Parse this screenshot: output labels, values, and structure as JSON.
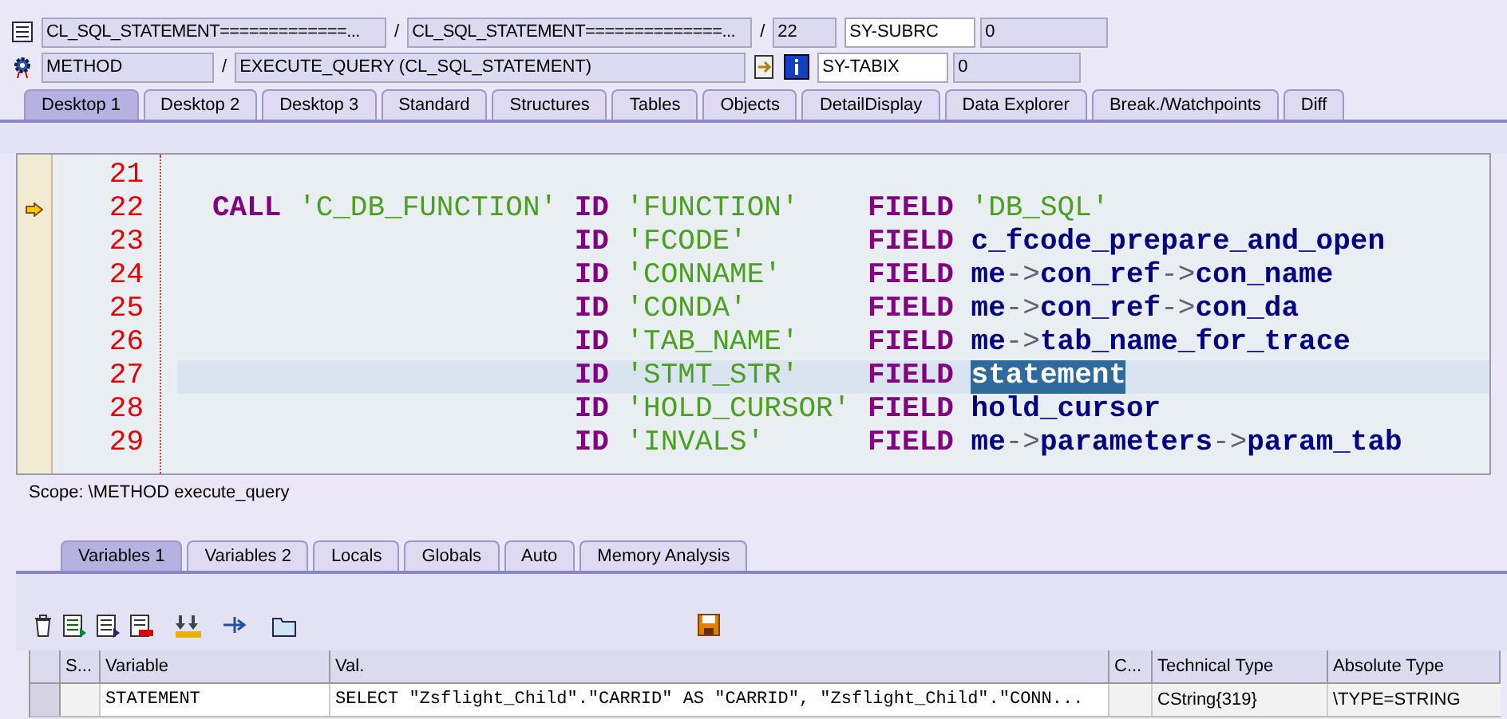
{
  "header_rows": [
    {
      "fields": [
        {
          "kind": "field",
          "text": "CL_SQL_STATEMENT=============..."
        },
        {
          "kind": "sep",
          "text": "/"
        },
        {
          "kind": "field",
          "text": "CL_SQL_STATEMENT==============..."
        },
        {
          "kind": "sep",
          "text": "/"
        },
        {
          "kind": "short",
          "text": "22"
        },
        {
          "kind": "label",
          "text": "SY-SUBRC"
        },
        {
          "kind": "value",
          "text": "0"
        }
      ]
    },
    {
      "fields": [
        {
          "kind": "medium",
          "text": "METHOD"
        },
        {
          "kind": "sep",
          "text": "/"
        },
        {
          "kind": "wide",
          "text": "EXECUTE_QUERY (CL_SQL_STATEMENT)"
        },
        {
          "kind": "buttons"
        },
        {
          "kind": "label",
          "text": "SY-TABIX"
        },
        {
          "kind": "value",
          "text": "0"
        }
      ]
    }
  ],
  "tabs": [
    {
      "label": "Desktop 1",
      "selected": true
    },
    {
      "label": "Desktop 2",
      "selected": false
    },
    {
      "label": "Desktop 3",
      "selected": false
    },
    {
      "label": "Standard",
      "selected": false
    },
    {
      "label": "Structures",
      "selected": false
    },
    {
      "label": "Tables",
      "selected": false
    },
    {
      "label": "Objects",
      "selected": false
    },
    {
      "label": "DetailDisplay",
      "selected": false
    },
    {
      "label": "Data Explorer",
      "selected": false
    },
    {
      "label": "Break./Watchpoints",
      "selected": false
    },
    {
      "label": "Diff",
      "selected": false
    }
  ],
  "code": {
    "lines": [
      {
        "number": "21",
        "current": false,
        "highlighted": false,
        "columns": [
          [],
          [],
          []
        ]
      },
      {
        "number": "22",
        "current": true,
        "highlighted": false,
        "columns": [
          [
            {
              "kind": "keyword",
              "text": "CALL"
            },
            {
              "kind": "string",
              "text": "'C_DB_FUNCTION'"
            }
          ],
          [
            {
              "kind": "keyword",
              "text": "ID"
            },
            {
              "kind": "string",
              "text": "'FUNCTION'"
            }
          ],
          [
            {
              "kind": "keyword",
              "text": "FIELD"
            },
            {
              "kind": "string",
              "text": "'DB_SQL'"
            }
          ]
        ]
      },
      {
        "number": "23",
        "current": false,
        "highlighted": false,
        "columns": [
          [],
          [
            {
              "kind": "keyword",
              "text": "ID"
            },
            {
              "kind": "string",
              "text": "'FCODE'"
            }
          ],
          [
            {
              "kind": "keyword",
              "text": "FIELD"
            },
            {
              "kind": "ident",
              "text": "c_fcode_prepare_and_open"
            }
          ]
        ]
      },
      {
        "number": "24",
        "current": false,
        "highlighted": false,
        "columns": [
          [],
          [
            {
              "kind": "keyword",
              "text": "ID"
            },
            {
              "kind": "string",
              "text": "'CONNAME'"
            }
          ],
          [
            {
              "kind": "keyword",
              "text": "FIELD"
            },
            {
              "kind": "ident",
              "text": "me"
            },
            {
              "kind": "arrow",
              "text": "->"
            },
            {
              "kind": "ident",
              "text": "con_ref"
            },
            {
              "kind": "arrow",
              "text": "->"
            },
            {
              "kind": "ident",
              "text": "con_name"
            }
          ]
        ]
      },
      {
        "number": "25",
        "current": false,
        "highlighted": false,
        "columns": [
          [],
          [
            {
              "kind": "keyword",
              "text": "ID"
            },
            {
              "kind": "string",
              "text": "'CONDA'"
            }
          ],
          [
            {
              "kind": "keyword",
              "text": "FIELD"
            },
            {
              "kind": "ident",
              "text": "me"
            },
            {
              "kind": "arrow",
              "text": "->"
            },
            {
              "kind": "ident",
              "text": "con_ref"
            },
            {
              "kind": "arrow",
              "text": "->"
            },
            {
              "kind": "ident",
              "text": "con_da"
            }
          ]
        ]
      },
      {
        "number": "26",
        "current": false,
        "highlighted": false,
        "columns": [
          [],
          [
            {
              "kind": "keyword",
              "text": "ID"
            },
            {
              "kind": "string",
              "text": "'TAB_NAME'"
            }
          ],
          [
            {
              "kind": "keyword",
              "text": "FIELD"
            },
            {
              "kind": "ident",
              "text": "me"
            },
            {
              "kind": "arrow",
              "text": "->"
            },
            {
              "kind": "ident",
              "text": "tab_name_for_trace"
            }
          ]
        ]
      },
      {
        "number": "27",
        "current": false,
        "highlighted": true,
        "columns": [
          [],
          [
            {
              "kind": "keyword",
              "text": "ID"
            },
            {
              "kind": "string",
              "text": "'STMT_STR'"
            }
          ],
          [
            {
              "kind": "keyword",
              "text": "FIELD"
            },
            {
              "kind": "selection",
              "text": "statement"
            }
          ]
        ]
      },
      {
        "number": "28",
        "current": false,
        "highlighted": false,
        "columns": [
          [],
          [
            {
              "kind": "keyword",
              "text": "ID"
            },
            {
              "kind": "string",
              "text": "'HOLD_CURSOR'"
            }
          ],
          [
            {
              "kind": "keyword",
              "text": "FIELD"
            },
            {
              "kind": "ident",
              "text": "hold_cursor"
            }
          ]
        ]
      },
      {
        "number": "29",
        "current": false,
        "highlighted": false,
        "columns": [
          [],
          [
            {
              "kind": "keyword",
              "text": "ID"
            },
            {
              "kind": "string",
              "text": "'INVALS'"
            }
          ],
          [
            {
              "kind": "keyword",
              "text": "FIELD"
            },
            {
              "kind": "ident",
              "text": "me"
            },
            {
              "kind": "arrow",
              "text": "->"
            },
            {
              "kind": "ident",
              "text": "parameters"
            },
            {
              "kind": "arrow",
              "text": "->"
            },
            {
              "kind": "ident",
              "text": "param_tab"
            }
          ]
        ]
      }
    ]
  },
  "scope": "Scope: \\METHOD execute_query",
  "bottom_tabs": [
    {
      "label": "Variables 1",
      "selected": true
    },
    {
      "label": "Variables 2",
      "selected": false
    },
    {
      "label": "Locals",
      "selected": false
    },
    {
      "label": "Globals",
      "selected": false
    },
    {
      "label": "Auto",
      "selected": false
    },
    {
      "label": "Memory Analysis",
      "selected": false
    }
  ],
  "table": {
    "columns": [
      "S...",
      "Variable",
      "Val.",
      "C...",
      "Technical Type",
      "Absolute Type"
    ],
    "rows": [
      {
        "variable": "STATEMENT",
        "value": "SELECT \"Zsflight_Child\".\"CARRID\" AS \"CARRID\", \"Zsflight_Child\".\"CONN...",
        "technical_type": "CString{319}",
        "absolute_type": "\\TYPE=STRING"
      }
    ]
  }
}
